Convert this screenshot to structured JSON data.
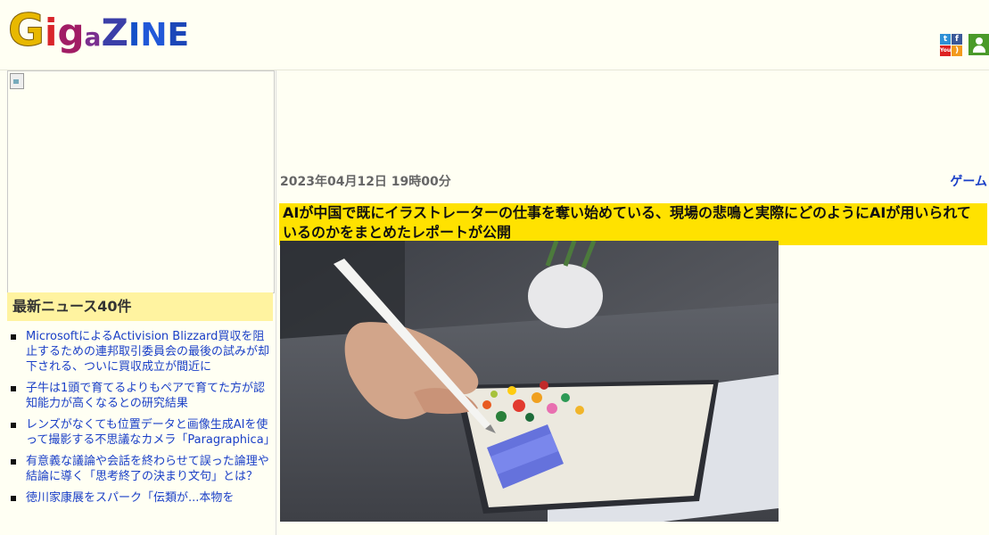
{
  "site": {
    "logo_parts": [
      "G",
      "i",
      "g",
      "a",
      "Z",
      "I",
      "N",
      "E"
    ]
  },
  "header": {
    "social": {
      "twitter": "t",
      "facebook": "f",
      "youtube": "You",
      "rss": ")"
    }
  },
  "sidebar": {
    "news_title": "最新ニュース40件",
    "news_items": [
      "MicrosoftによるActivision Blizzard買収を阻止するための連邦取引委員会の最後の試みが却下される、ついに買収成立が間近に",
      "子牛は1頭で育てるよりもペアで育てた方が認知能力が高くなるとの研究結果",
      "レンズがなくても位置データと画像生成AIを使って撮影する不思議なカメラ「Paragraphica」",
      "有意義な議論や会話を終わらせて誤った論理や結論に導く「思考終了の決まり文句」とは？",
      "徳川家康展をスパーク「伝類が...本物を"
    ]
  },
  "article": {
    "date": "2023年04月12日 19時00分",
    "category": "ゲーム",
    "title": "AIが中国で既にイラストレーターの仕事を奪い始めている、現場の悲鳴と実際にどのようにAIが用いられているのかをまとめたレポートが公開"
  },
  "colors": {
    "page_bg": "#fffff3",
    "headline_bg": "#ffe200",
    "sidebar_title_bg": "#fff3a0",
    "link": "#1a3fc7"
  }
}
